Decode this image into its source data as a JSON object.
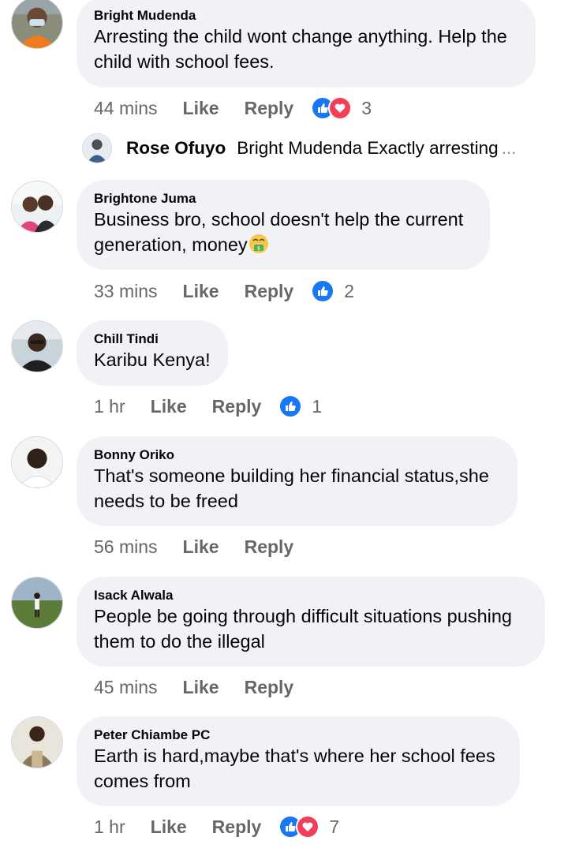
{
  "reaction_colors": {
    "like": "#1877f2",
    "love": "#f33e58"
  },
  "comments": [
    {
      "author": "Bright Mudenda",
      "lines": [
        "Arresting the child wont change anything. Help the",
        "child with school fees."
      ],
      "time": "44 mins",
      "like_label": "Like",
      "reply_label": "Reply",
      "reactions": [
        "like-icon",
        "love-icon"
      ],
      "count": "3"
    },
    {
      "author": "Brightone Juma",
      "lines": [
        "Business bro, school doesn't help the current",
        "generation, money"
      ],
      "emoji": "money-mouth-face",
      "time": "33 mins",
      "like_label": "Like",
      "reply_label": "Reply",
      "reactions": [
        "like-icon"
      ],
      "count": "2"
    },
    {
      "author": "Chill Tindi",
      "lines": [
        "Karibu Kenya!"
      ],
      "time": "1 hr",
      "like_label": "Like",
      "reply_label": "Reply",
      "reactions": [
        "like-icon"
      ],
      "count": "1"
    },
    {
      "author": "Bonny Oriko",
      "lines": [
        "That's someone building her financial status,she",
        "needs to be freed"
      ],
      "time": "56 mins",
      "like_label": "Like",
      "reply_label": "Reply"
    },
    {
      "author": "Isack Alwala",
      "lines": [
        "People be going through difficult situations pushing",
        "them to do the illegal"
      ],
      "time": "45 mins",
      "like_label": "Like",
      "reply_label": "Reply"
    },
    {
      "author": "Peter Chiambe PC",
      "lines": [
        "Earth is hard,maybe that's where her school fees",
        "comes from"
      ],
      "time": "1 hr",
      "like_label": "Like",
      "reply_label": "Reply",
      "reactions": [
        "like-icon",
        "love-icon"
      ],
      "count": "7"
    }
  ],
  "reply_preview": {
    "author": "Rose Ofuyo",
    "text": "Bright Mudenda Exactly arresting",
    "ellipsis": "..."
  }
}
